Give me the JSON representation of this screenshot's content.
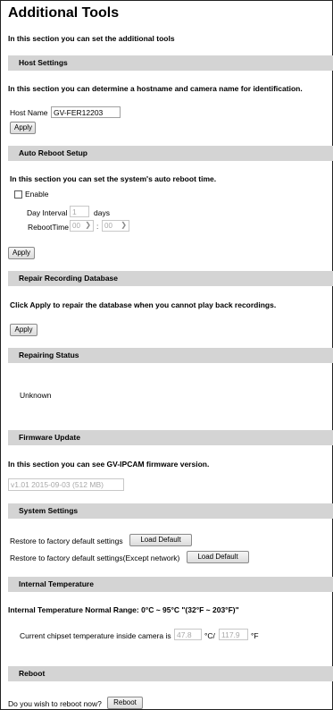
{
  "page": {
    "title": "Additional Tools",
    "intro": "In this section you can set the additional tools"
  },
  "host": {
    "header": "Host Settings",
    "desc": "In this section you can determine a hostname and camera name for identification.",
    "name_label": "Host Name",
    "name_value": "GV-FER12203",
    "apply": "Apply"
  },
  "reboot_setup": {
    "header": "Auto Reboot Setup",
    "desc": "In this section you can set the system's auto reboot time.",
    "enable_label": "Enable",
    "enable_checked": false,
    "interval_label": "Day Interval",
    "interval_value": "1",
    "days_label": "days",
    "time_label": "RebootTime",
    "hour": "00",
    "colon": ":",
    "minute": "00",
    "apply": "Apply"
  },
  "repair": {
    "header": "Repair Recording Database",
    "desc": "Click Apply to repair the database when you cannot play back recordings.",
    "apply": "Apply"
  },
  "status": {
    "header": "Repairing Status",
    "value": "Unknown"
  },
  "firmware": {
    "header": "Firmware Update",
    "desc": "In this section you can see GV-IPCAM firmware version.",
    "version": "v1.01 2015-09-03 (512 MB)"
  },
  "system": {
    "header": "System Settings",
    "restore_label": "Restore to factory default settings",
    "restore_button": "Load Default",
    "restore_net_label": "Restore to factory default settings(Except network)",
    "restore_net_button": "Load Default"
  },
  "temperature": {
    "header": "Internal Temperature",
    "range": "Internal Temperature Normal Range: 0°C ~ 95°C \"(32°F ~ 203°F)\"",
    "current_label": "Current chipset temperature inside camera is",
    "celsius": "47.8",
    "c_unit": "°C/",
    "fahrenheit": "117.9",
    "f_unit": "°F"
  },
  "reboot": {
    "header": "Reboot",
    "question": "Do you wish to reboot now?",
    "button": "Reboot"
  },
  "icons": {
    "dropdown": "chevron-down-icon"
  },
  "colors": {
    "section_bar": "#d4d4d4"
  }
}
